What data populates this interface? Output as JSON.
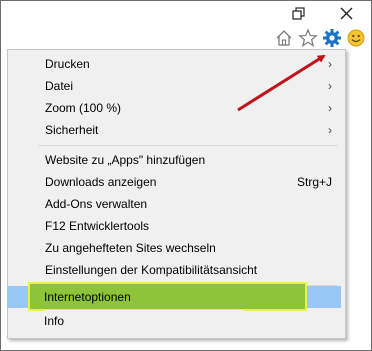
{
  "toolbar": {
    "icons": [
      "restore-icon",
      "close-icon",
      "home-icon",
      "favorites-star-icon",
      "tools-gear-icon",
      "smiley-feedback-icon"
    ]
  },
  "menu": {
    "groups": [
      [
        {
          "label": "Drucken",
          "submenu": true,
          "chevron": "›"
        },
        {
          "label": "Datei",
          "submenu": true,
          "chevron": "›"
        },
        {
          "label": "Zoom (100 %)",
          "submenu": true,
          "chevron": "›"
        },
        {
          "label": "Sicherheit",
          "submenu": true,
          "chevron": "›"
        }
      ],
      [
        {
          "label": "Website zu „Apps\" hinzufügen"
        },
        {
          "label": "Downloads anzeigen",
          "shortcut": "Strg+J"
        },
        {
          "label": "Add-Ons verwalten"
        },
        {
          "label": "F12 Entwicklertools"
        },
        {
          "label": "Zu angehefteten Sites wechseln"
        },
        {
          "label": "Einstellungen der Kompatibilitätsansicht"
        }
      ],
      [
        {
          "label": "Internetoptionen",
          "highlighted": true
        },
        {
          "label": "Info"
        }
      ]
    ]
  },
  "colors": {
    "menu_bg": "#f0f0f0",
    "highlight_blue": "#99c8f6",
    "highlight_green": "#8dc43a",
    "highlight_border": "#e9ef52",
    "arrow": "#c0141c",
    "gear": "#1a73c7"
  }
}
